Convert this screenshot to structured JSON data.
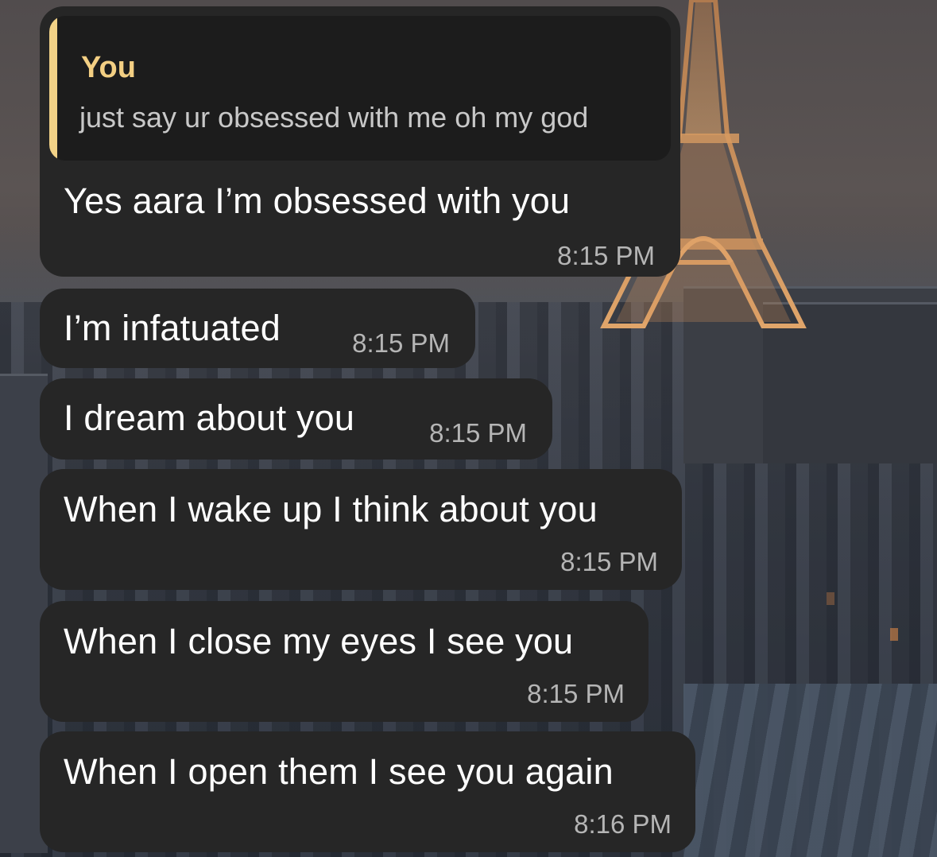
{
  "colors": {
    "bubble": "#262626",
    "quote_accent": "#f2d287",
    "quote_name": "#f3cf83",
    "time_text": "#b5b5b5"
  },
  "reply": {
    "quoted_sender": "You",
    "quoted_text": "just say ur obsessed with me oh my god"
  },
  "messages": [
    {
      "text": "Yes aara I’m obsessed with you",
      "time": "8:15 PM"
    },
    {
      "text": "I’m infatuated",
      "time": "8:15 PM"
    },
    {
      "text": "I dream about you",
      "time": "8:15 PM"
    },
    {
      "text": "When I wake up I think about you",
      "time": "8:15 PM"
    },
    {
      "text": "When I close my eyes I see you",
      "time": "8:15 PM"
    },
    {
      "text": "When I open them I see you again",
      "time": "8:16 PM"
    }
  ]
}
